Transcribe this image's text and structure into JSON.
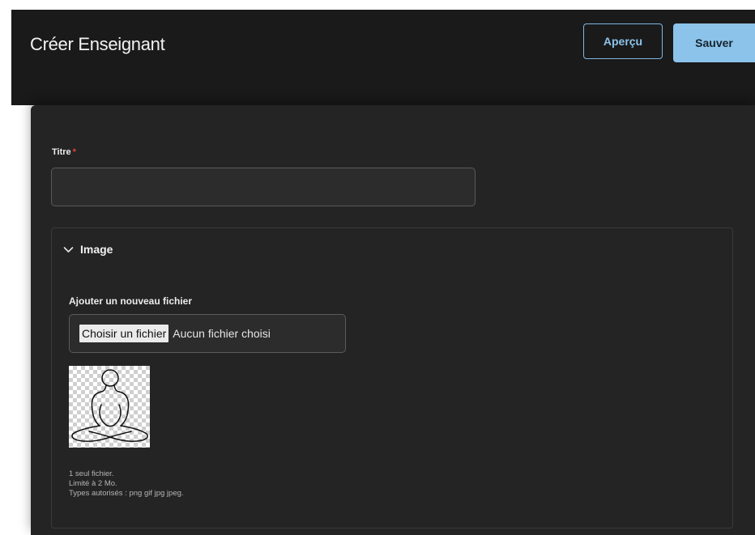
{
  "header": {
    "title": "Créer Enseignant",
    "preview_label": "Aperçu",
    "save_label": "Sauver"
  },
  "form": {
    "title_field": {
      "label": "Titre",
      "required_marker": "*",
      "value": ""
    },
    "image_section": {
      "title": "Image",
      "expanded": true,
      "upload_label": "Ajouter un nouveau fichier",
      "choose_button": "Choisir un fichier",
      "file_status": "Aucun fichier choisi",
      "preview_icon": "meditation-figure-icon",
      "help_lines": [
        "1 seul fichier.",
        "Limité à 2 Mo.",
        "Types autorisés : png gif jpg jpeg."
      ]
    }
  },
  "colors": {
    "accent": "#8cc3ea",
    "required": "#e0443c",
    "background": "#1a1a1b",
    "panel": "#242425"
  }
}
